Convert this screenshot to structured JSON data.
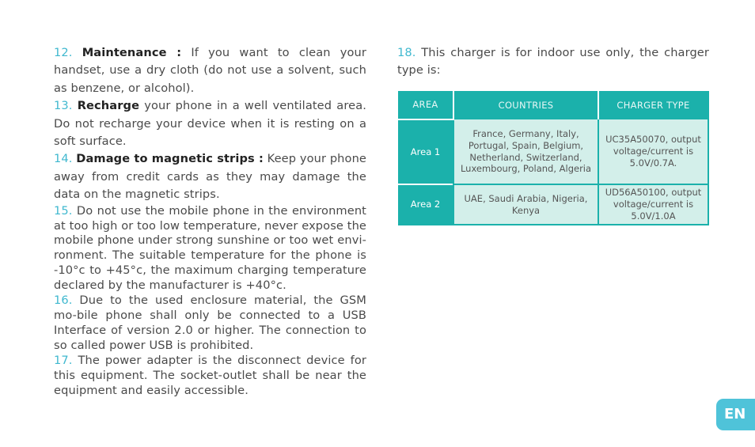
{
  "left_column": {
    "items": [
      {
        "number": "12.",
        "title": "Maintenance :",
        "text": " If you want to clean your handset, use a dry cloth (do not use a solvent, such as benzene, or alcohol)."
      },
      {
        "number": "13.",
        "title": "Recharge",
        "text": " your phone in a well ventilated area. Do not recharge your device when it is resting on a soft surface."
      },
      {
        "number": "14.",
        "title": "Damage to magnetic strips :",
        "text": " Keep your phone away from credit cards as they may damage the data on the magnetic strips."
      },
      {
        "number": "15.",
        "text": " Do not use the mobile phone in the environment at too high or too low temperature, never expose the mobile phone under strong sunshine or too wet envi-ronment. The suitable temperature for the phone is -10°c to +45°c, the maximum charging temperature declared by the manufacturer is +40°c."
      },
      {
        "number": "16.",
        "text": " Due to the used enclosure material, the GSM mo-bile phone shall only be connected to a USB Interface of version 2.0 or higher. The connection to so called power USB is prohibited."
      },
      {
        "number": "17.",
        "text": " The power adapter is the disconnect device for this equipment. The socket-outlet shall be near the equipment and easily accessible."
      }
    ]
  },
  "right_column": {
    "item": {
      "number": "18.",
      "text": " This charger is for indoor use only, the charger type is:"
    },
    "table": {
      "headers": [
        "AREA",
        "COUNTRIES",
        "CHARGER TYPE"
      ],
      "rows": [
        {
          "area": "Area 1",
          "countries": "France, Germany, Italy, Portugal, Spain, Belgium, Netherland, Switzerland, Luxembourg, Poland, Algeria",
          "charger": "UC35A50070, output voltage/current is 5.0V/0.7A."
        },
        {
          "area": "Area 2",
          "countries": "UAE, Saudi Arabia, Nigeria, Kenya",
          "charger": "UD56A50100, output voltage/current is 5.0V/1.0A"
        }
      ]
    }
  },
  "language_tab": {
    "label": "EN"
  },
  "colors": {
    "accent": "#3fb8cf",
    "table_header": "#1bb1ab",
    "table_cell": "#d3efea",
    "lang_tab": "#4fc3d9"
  }
}
